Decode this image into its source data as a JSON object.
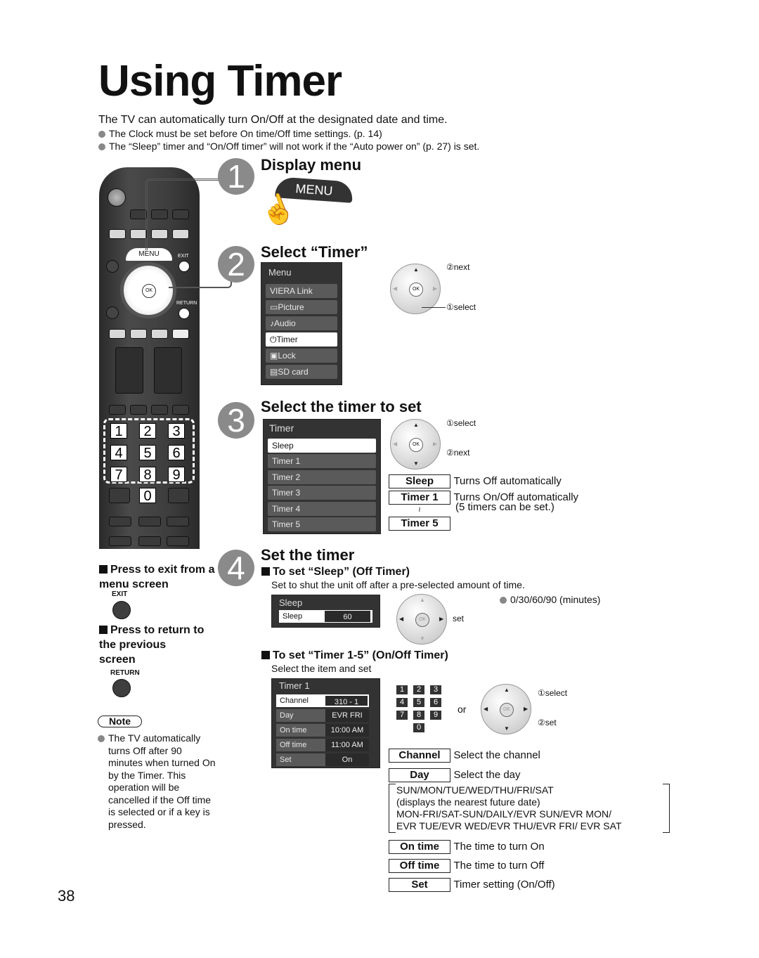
{
  "page": {
    "title": "Using Timer",
    "intro": "The TV can automatically turn On/Off at the designated date and time.",
    "bullets": [
      "The Clock must be set before On time/Off time settings. (p. 14)",
      "The “Sleep” timer and “On/Off timer” will not work if the “Auto power on” (p. 27) is set."
    ],
    "page_number": "38"
  },
  "remote": {
    "menu_label": "MENU",
    "exit_label": "EXIT",
    "return_label": "RETURN",
    "ok_label": "OK",
    "number_keys": [
      "1",
      "2",
      "3",
      "4",
      "5",
      "6",
      "7",
      "8",
      "9",
      "0"
    ]
  },
  "step1": {
    "number": "1",
    "heading": "Display menu",
    "button_label": "MENU"
  },
  "step2": {
    "number": "2",
    "heading": "Select “Timer”",
    "menu_title": "Menu",
    "menu_items": [
      {
        "icon": "",
        "label": "VIERA Link"
      },
      {
        "icon": "▭",
        "label": "Picture"
      },
      {
        "icon": "♪",
        "label": "Audio"
      },
      {
        "icon": "⏻",
        "label": "Timer"
      },
      {
        "icon": "▣",
        "label": "Lock"
      },
      {
        "icon": "▤",
        "label": "SD card"
      }
    ],
    "selected_index": 3,
    "ann_next": "②next",
    "ann_select": "①select"
  },
  "step3": {
    "number": "3",
    "heading": "Select the timer to set",
    "menu_title": "Timer",
    "menu_items": [
      "Sleep",
      "Timer 1",
      "Timer 2",
      "Timer 3",
      "Timer 4",
      "Timer 5"
    ],
    "selected_index": 0,
    "ann_select": "①select",
    "ann_next": "②next",
    "legend": [
      {
        "key": "Sleep",
        "desc": "Turns Off automatically"
      },
      {
        "key": "Timer 1",
        "desc": "Turns On/Off automatically"
      },
      {
        "key": "Timer 5",
        "desc": "(5 timers can be set.)"
      }
    ],
    "tilde": "≀"
  },
  "step4": {
    "number": "4",
    "heading": "Set the timer",
    "sleep": {
      "subhead": "To set “Sleep” (Off Timer)",
      "desc": "Set to shut the unit off after a pre-selected amount of time.",
      "panel_title": "Sleep",
      "row_label": "Sleep",
      "row_value": "60",
      "options_note": "0/30/60/90 (minutes)",
      "ann_set": "set"
    },
    "timer": {
      "subhead": "To set “Timer 1-5” (On/Off Timer)",
      "desc": "Select the item and set",
      "panel_title": "Timer 1",
      "rows": [
        {
          "label": "Channel",
          "value": "310 - 1"
        },
        {
          "label": "Day",
          "value": "EVR FRI"
        },
        {
          "label": "On time",
          "value": "10:00 AM"
        },
        {
          "label": "Off time",
          "value": "11:00 AM"
        },
        {
          "label": "Set",
          "value": "On"
        }
      ],
      "or_label": "or",
      "ann_select": "①select",
      "ann_set": "②set",
      "legend": [
        {
          "key": "Channel",
          "desc": "Select the channel"
        },
        {
          "key": "Day",
          "desc": "Select the day"
        },
        {
          "key": "On time",
          "desc": "The time to turn On"
        },
        {
          "key": "Off time",
          "desc": "The time to turn Off"
        },
        {
          "key": "Set",
          "desc": "Timer setting (On/Off)"
        }
      ],
      "day_options": [
        "SUN/MON/TUE/WED/THU/FRI/SAT",
        "(displays the nearest future date)",
        "MON-FRI/SAT-SUN/DAILY/EVR SUN/EVR MON/",
        "EVR TUE/EVR WED/EVR THU/EVR FRI/ EVR SAT"
      ]
    }
  },
  "sidebar": {
    "exit_heading": "Press to exit from a menu screen",
    "exit_label": "EXIT",
    "return_heading": "Press to return to the previous screen",
    "return_label": "RETURN",
    "note_label": "Note",
    "note_text": "The TV automatically turns Off after 90 minutes when turned On by the Timer. This operation will be cancelled if the Off time is selected or if a key is pressed."
  }
}
